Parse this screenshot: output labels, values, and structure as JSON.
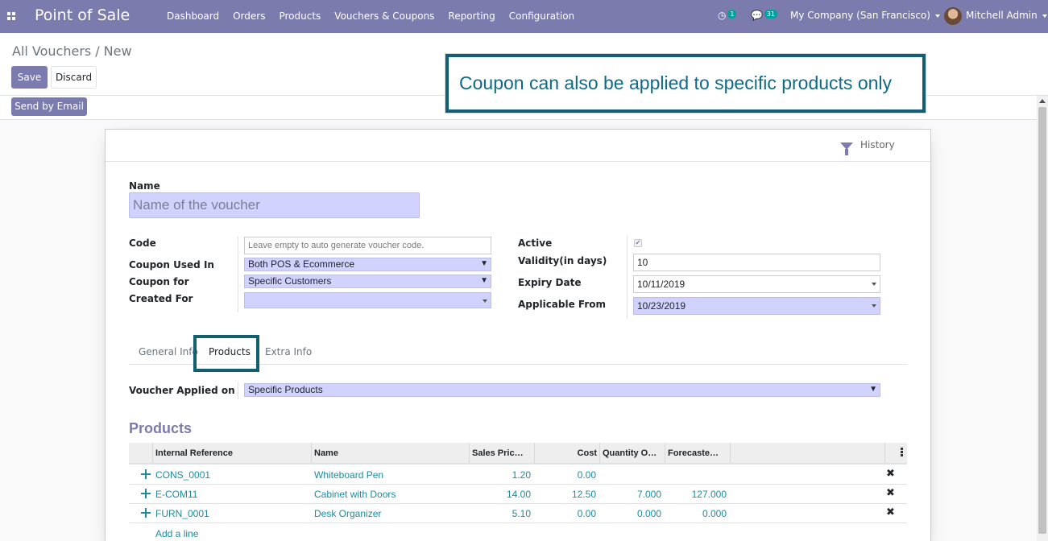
{
  "navbar": {
    "app_title": "Point of Sale",
    "menu": [
      "Dashboard",
      "Orders",
      "Products",
      "Vouchers & Coupons",
      "Reporting",
      "Configuration"
    ],
    "activity_count": "1",
    "message_count": "31",
    "company": "My Company (San Francisco)",
    "user": "Mitchell Admin"
  },
  "control": {
    "breadcrumb_parent": "All Vouchers",
    "breadcrumb_sep": "/",
    "breadcrumb_current": "New",
    "save_label": "Save",
    "discard_label": "Discard",
    "send_email_label": "Send by Email"
  },
  "callout": {
    "text": "Coupon can also be applied to specific products only"
  },
  "sheet": {
    "history_label": "History",
    "name_label": "Name",
    "name_placeholder": "Name of the voucher",
    "left_fields": [
      {
        "label": "Code",
        "value": "Leave empty to auto generate voucher code."
      },
      {
        "label": "Coupon Used In",
        "value": "Both POS & Ecommerce"
      },
      {
        "label": "Coupon for",
        "value": "Specific Customers"
      },
      {
        "label": "Created For",
        "value": ""
      }
    ],
    "right_fields": [
      {
        "label": "Active",
        "value": "✔"
      },
      {
        "label": "Validity(in days)",
        "value": "10"
      },
      {
        "label": "Expiry Date",
        "value": "10/11/2019"
      },
      {
        "label": "Applicable From",
        "value": "10/23/2019"
      }
    ],
    "tabs": [
      "General Info",
      "Products",
      "Extra Info"
    ],
    "applied_on_label": "Voucher Applied on",
    "applied_on_value": "Specific Products",
    "products_title": "Products",
    "table": {
      "headers": [
        "Internal Reference",
        "Name",
        "Sales Pric…",
        "Cost",
        "Quantity O…",
        "Forecaste…"
      ],
      "rows": [
        [
          "CONS_0001",
          "Whiteboard Pen",
          "1.20",
          "0.00",
          "",
          ""
        ],
        [
          "E-COM11",
          "Cabinet with Doors",
          "14.00",
          "12.50",
          "7.000",
          "127.000"
        ],
        [
          "FURN_0001",
          "Desk Organizer",
          "5.10",
          "0.00",
          "0.000",
          "0.000"
        ]
      ],
      "add_line_label": "Add a line"
    }
  },
  "colors": {
    "primary": "#7c7bad",
    "accent": "#00a09d",
    "callout_border": "#135f72"
  }
}
